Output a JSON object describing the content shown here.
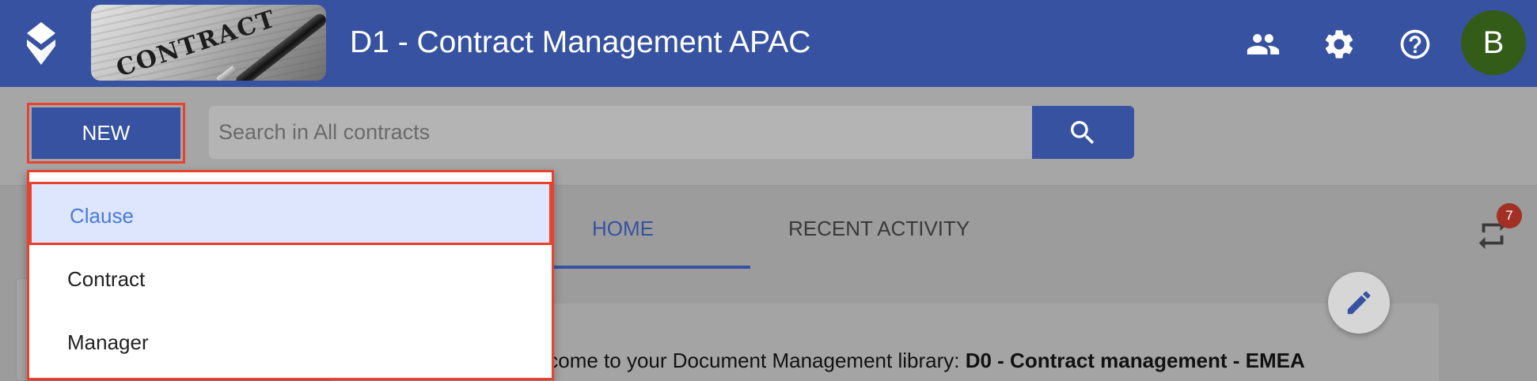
{
  "header": {
    "title": "D1 - Contract Management APAC",
    "banner_text": "CONTRACT",
    "avatar_initial": "B",
    "icons": [
      "app-logo-icon",
      "people-icon",
      "gear-icon",
      "help-icon"
    ]
  },
  "toolbar": {
    "new_label": "NEW",
    "search_placeholder": "Search in All contracts"
  },
  "new_menu": {
    "items": [
      "Clause",
      "Contract",
      "Manager"
    ],
    "selected": "Clause"
  },
  "tabs": [
    {
      "label": "HOME",
      "active": true
    },
    {
      "label": "RECENT ACTIVITY",
      "active": false
    }
  ],
  "notifications": {
    "count": "7"
  },
  "welcome": {
    "prefix": "elcome to your Document Management library: ",
    "library": "D0 - Contract management - EMEA"
  },
  "colors": {
    "brand_blue": "#3652a1",
    "highlight_red": "#e8422e",
    "menu_selected_bg": "#dde6fd",
    "avatar_green": "#335c18"
  }
}
